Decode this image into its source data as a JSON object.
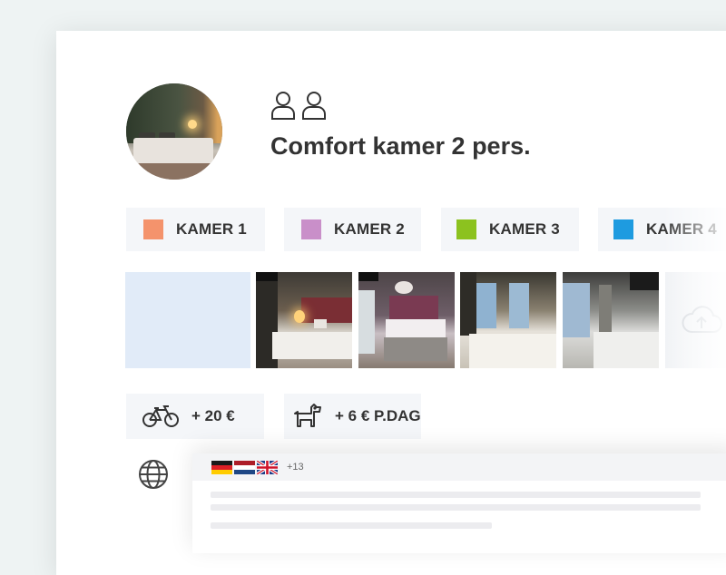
{
  "room": {
    "title": "Comfort kamer 2 pers.",
    "persons_icons": [
      "person-icon",
      "person-icon"
    ]
  },
  "tabs": [
    {
      "label": "KAMER 1",
      "color": "#f4936c"
    },
    {
      "label": "KAMER 2",
      "color": "#c98fc9"
    },
    {
      "label": "KAMER 3",
      "color": "#8cc21f"
    },
    {
      "label": "KAMER 4",
      "color": "#1e9be0"
    }
  ],
  "photos": {
    "icons": [
      "upload-cloud-icon"
    ]
  },
  "addons": [
    {
      "icon": "bicycle-icon",
      "value": "+ 20 €"
    },
    {
      "icon": "dog-icon",
      "value": "+ 6 € P.DAG"
    }
  ],
  "languages": {
    "icon": "globe-icon",
    "flags": [
      "de",
      "nl",
      "gb"
    ],
    "more": "+13"
  }
}
